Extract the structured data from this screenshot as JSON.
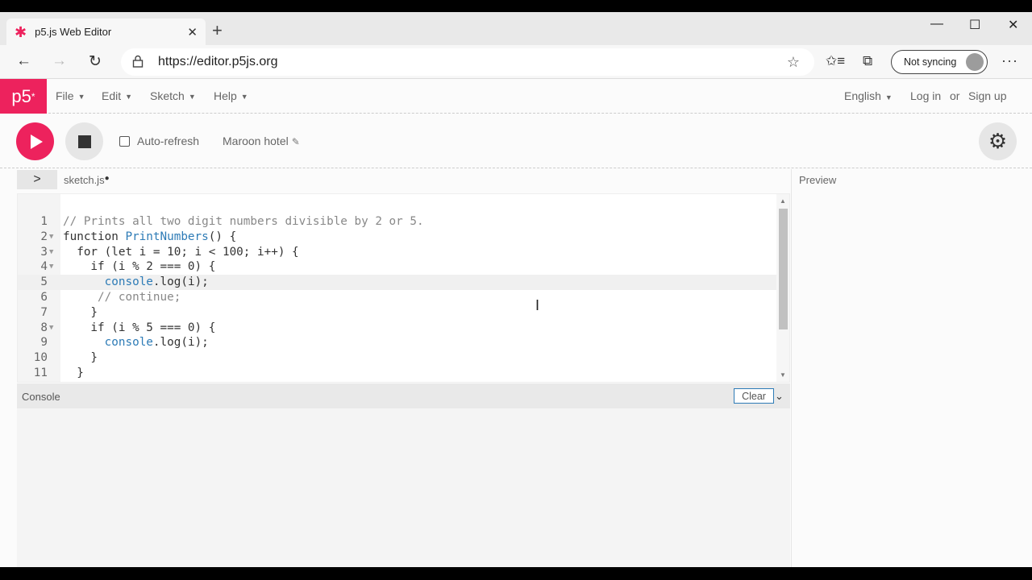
{
  "browser": {
    "tab_title": "p5.js Web Editor",
    "tab_favicon": "p5-asterisk-icon",
    "close_glyph": "✕",
    "new_tab_glyph": "+",
    "url": "https://editor.p5js.org",
    "sync_label": "Not syncing",
    "window_controls": {
      "minimize": "—",
      "maximize": "☐",
      "close": "✕"
    }
  },
  "app": {
    "logo_text": "p5",
    "logo_mark": "*",
    "menus": [
      {
        "label": "File"
      },
      {
        "label": "Edit"
      },
      {
        "label": "Sketch"
      },
      {
        "label": "Help"
      }
    ],
    "language": "English",
    "login": "Log in",
    "or": "or",
    "signup": "Sign up",
    "auto_refresh_label": "Auto-refresh",
    "auto_refresh_checked": false,
    "project_name": "Maroon hotel",
    "file_name": "sketch.js",
    "unsaved_marker": "●",
    "preview_label": "Preview",
    "console_label": "Console",
    "clear_label": "Clear",
    "accent_color": "#ed225d"
  },
  "editor": {
    "active_line": 5,
    "lines": [
      {
        "n": "1",
        "text": "// Prints all two digit numbers divisible by 2 or 5.",
        "fold": ""
      },
      {
        "n": "2",
        "text": "function PrintNumbers() {",
        "fold": "▼"
      },
      {
        "n": "3",
        "text": "  for (let i = 10; i < 100; i++) {",
        "fold": "▼"
      },
      {
        "n": "4",
        "text": "    if (i % 2 === 0) {",
        "fold": "▼"
      },
      {
        "n": "5",
        "text": "      console.log(i);",
        "fold": ""
      },
      {
        "n": "6",
        "text": "     // continue;",
        "fold": ""
      },
      {
        "n": "7",
        "text": "    }",
        "fold": ""
      },
      {
        "n": "8",
        "text": "    if (i % 5 === 0) {",
        "fold": "▼"
      },
      {
        "n": "9",
        "text": "      console.log(i);",
        "fold": ""
      },
      {
        "n": "10",
        "text": "    }",
        "fold": ""
      },
      {
        "n": "11",
        "text": "  }",
        "fold": ""
      }
    ]
  }
}
